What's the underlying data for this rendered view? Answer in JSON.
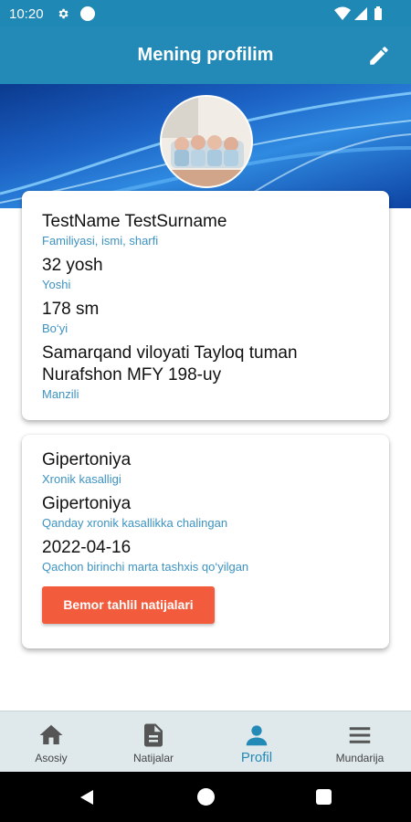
{
  "status_bar": {
    "time": "10:20"
  },
  "app_bar": {
    "title": "Mening profilim",
    "edit_icon": "pencil-icon"
  },
  "profile": {
    "full_name": {
      "value": "TestName TestSurname",
      "label": "Familiyasi, ismi, sharfi"
    },
    "age": {
      "value": "32 yosh",
      "label": "Yoshi"
    },
    "height": {
      "value": "178 sm",
      "label": "Bo‘yi"
    },
    "address": {
      "value": "Samarqand viloyati Tayloq tuman Nurafshon MFY 198-uy",
      "label": "Manzili"
    }
  },
  "medical": {
    "chronic_disease": {
      "value": "Gipertoniya",
      "label": "Xronik kasalligi"
    },
    "diagnosed_disease": {
      "value": "Gipertoniya",
      "label": "Qanday xronik kasallikka chalingan"
    },
    "first_diagnosis_date": {
      "value": "2022-04-16",
      "label": "Qachon birinchi marta tashxis qo‘yilgan"
    },
    "results_button": "Bemor tahlil natijalari"
  },
  "bottom_nav": {
    "active": "Profil",
    "items": [
      {
        "label": "Asosiy",
        "icon": "home-icon"
      },
      {
        "label": "Natijalar",
        "icon": "document-icon"
      },
      {
        "label": "Profil",
        "icon": "person-icon"
      },
      {
        "label": "Mundarija",
        "icon": "menu-icon"
      }
    ]
  },
  "colors": {
    "primary": "#2389b6",
    "accent_button": "#f25c3d",
    "label": "#3d93c2",
    "nav_background": "#dfe9ec"
  }
}
